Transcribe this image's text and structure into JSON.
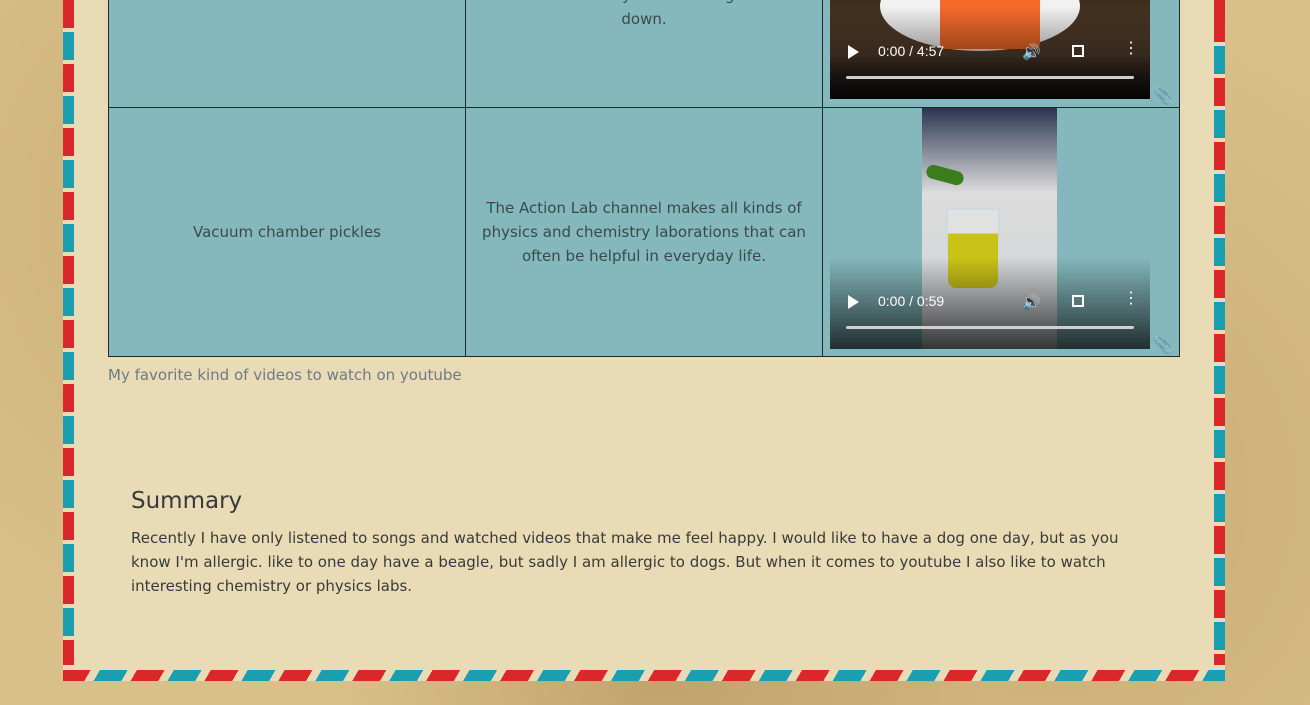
{
  "table": {
    "rows": [
      {
        "topic": "",
        "description": "to look at when you are feeling a little down.",
        "video": {
          "time": "0:00 / 4:57"
        }
      },
      {
        "topic": "Vacuum chamber pickles",
        "description": "The Action Lab channel makes all kinds of physics and chemistry laborations that can often be helpful in everyday life.",
        "video": {
          "time": "0:00 / 0:59"
        }
      }
    ],
    "caption": "My favorite kind of videos to watch on youtube"
  },
  "summary": {
    "title": "Summary",
    "text": "Recently I have only listened to songs and watched videos that make me feel happy. I would like to have a dog one day, but as you know I'm allergic. like to one day have a beagle, but sadly I am allergic to dogs. But when it comes to youtube I also like to watch interesting chemistry or physics labs."
  },
  "icons": {
    "video_controls": [
      "play-icon",
      "volume-icon",
      "fullscreen-icon",
      "more-options-icon"
    ],
    "attachment": "paperclip-icon"
  },
  "colors": {
    "stripe_red": "#d9272a",
    "stripe_teal": "#1a9fb0",
    "table_bg": "#84b8bc",
    "paper_bg": "#e8dbb5"
  }
}
